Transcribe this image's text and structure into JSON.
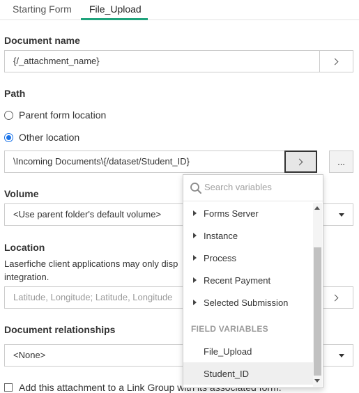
{
  "tabs": [
    {
      "label": "Starting Form",
      "active": false
    },
    {
      "label": "File_Upload",
      "active": true
    }
  ],
  "document_name": {
    "label": "Document name",
    "value": "{/_attachment_name}"
  },
  "path": {
    "label": "Path",
    "options": [
      {
        "label": "Parent form location",
        "checked": false
      },
      {
        "label": "Other location",
        "checked": true
      }
    ],
    "value": "\\Incoming Documents\\{/dataset/Student_ID}",
    "browse_label": "..."
  },
  "volume": {
    "label": "Volume",
    "value": "<Use parent folder's default volume>"
  },
  "location": {
    "label": "Location",
    "description": "Laserfiche client applications may only disp integration.",
    "placeholder": "Latitude, Longitude; Latitude, Longitude"
  },
  "document_relationships": {
    "label": "Document relationships",
    "value": "<None>"
  },
  "link_group": {
    "label": "Add this attachment to a Link Group with its associated form."
  },
  "variable_picker": {
    "search_placeholder": "Search variables",
    "groups": [
      "Forms Server",
      "Instance",
      "Process",
      "Recent Payment",
      "Selected Submission"
    ],
    "field_header": "FIELD VARIABLES",
    "fields": [
      "File_Upload",
      "Student_ID"
    ],
    "selected": "Student_ID"
  },
  "colors": {
    "accent": "#1fa37c",
    "radio_checked": "#1a73e8"
  }
}
